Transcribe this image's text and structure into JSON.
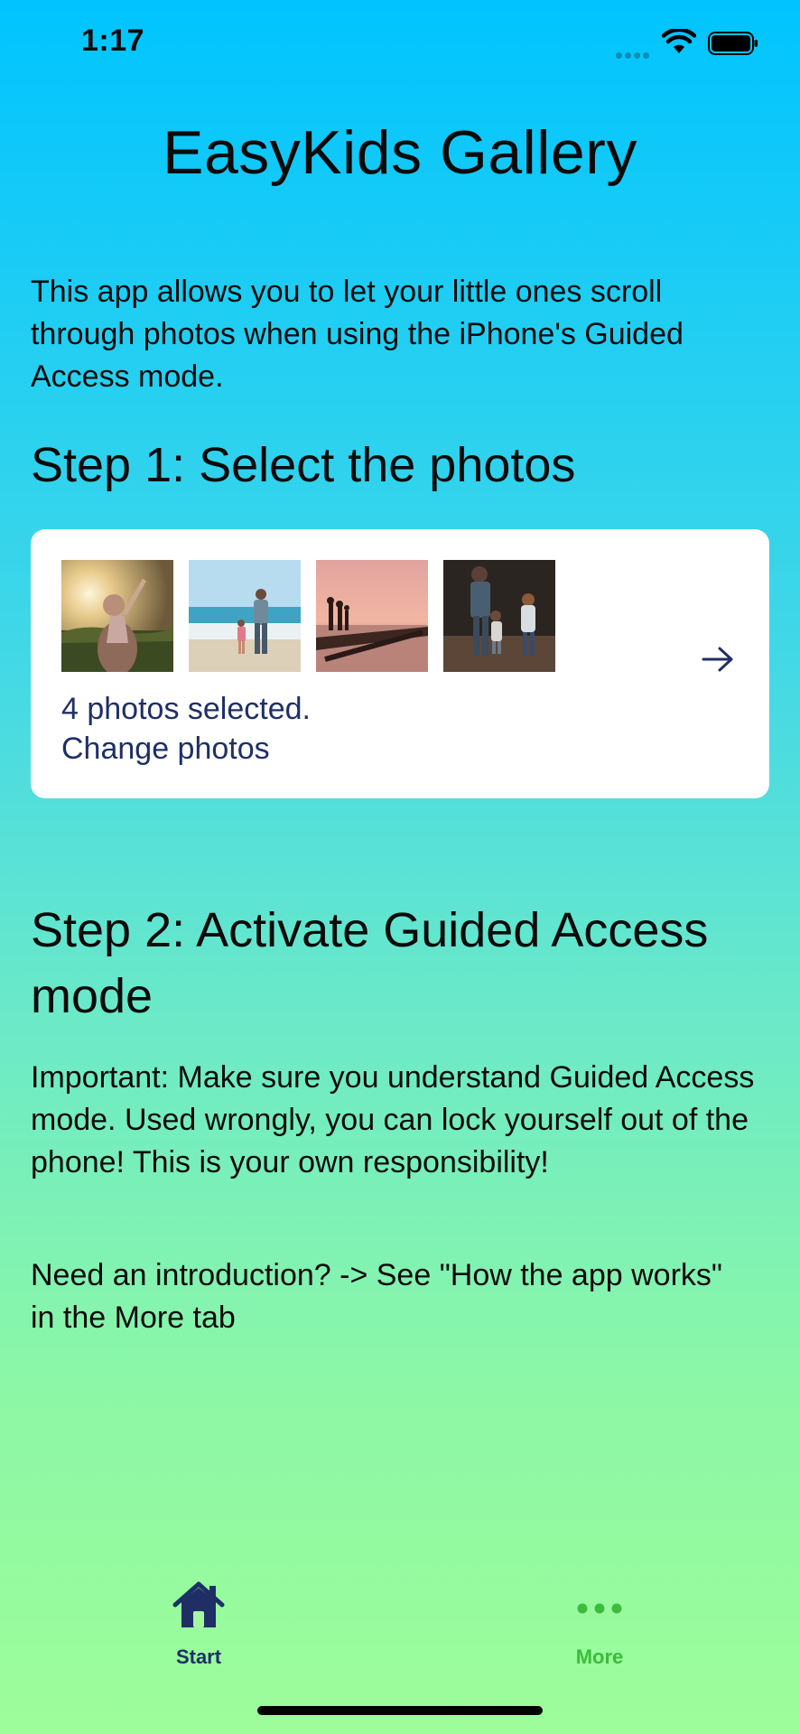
{
  "status_bar": {
    "time": "1:17",
    "signal_icon": "signal-dots-icon",
    "wifi_icon": "wifi-icon",
    "battery_icon": "battery-icon"
  },
  "app_title": "EasyKids Gallery",
  "intro_text": "This app allows you to let your little ones scroll through photos when using the iPhone's Guided Access mode.",
  "step1": {
    "heading": "Step 1: Select the photos",
    "photos_selected": "4 photos selected.",
    "change_photos": "Change photos",
    "arrow_icon": "arrow-right-icon",
    "thumbnails": [
      {
        "name": "child-at-sunset"
      },
      {
        "name": "parent-child-beach"
      },
      {
        "name": "pier-at-sunset"
      },
      {
        "name": "family-walking"
      }
    ]
  },
  "step2": {
    "heading": "Step 2: Activate Guided Access mode",
    "important_text": "Important: Make sure you understand Guided Access mode. Used wrongly, you can lock yourself out of the phone! This is your own responsibility!",
    "intro_hint": "Need an introduction? -> See \"How the app works\" in the More tab"
  },
  "tab_bar": {
    "tabs": [
      {
        "label": "Start",
        "icon": "home-icon",
        "selected": true
      },
      {
        "label": "More",
        "icon": "more-dots-icon",
        "selected": false
      }
    ]
  },
  "colors": {
    "gradient_top": "#00c4ff",
    "gradient_bottom": "#9dfd9a",
    "accent_navy": "#1f2f66",
    "accent_green": "#3cbb3c",
    "card_background": "#ffffff"
  }
}
